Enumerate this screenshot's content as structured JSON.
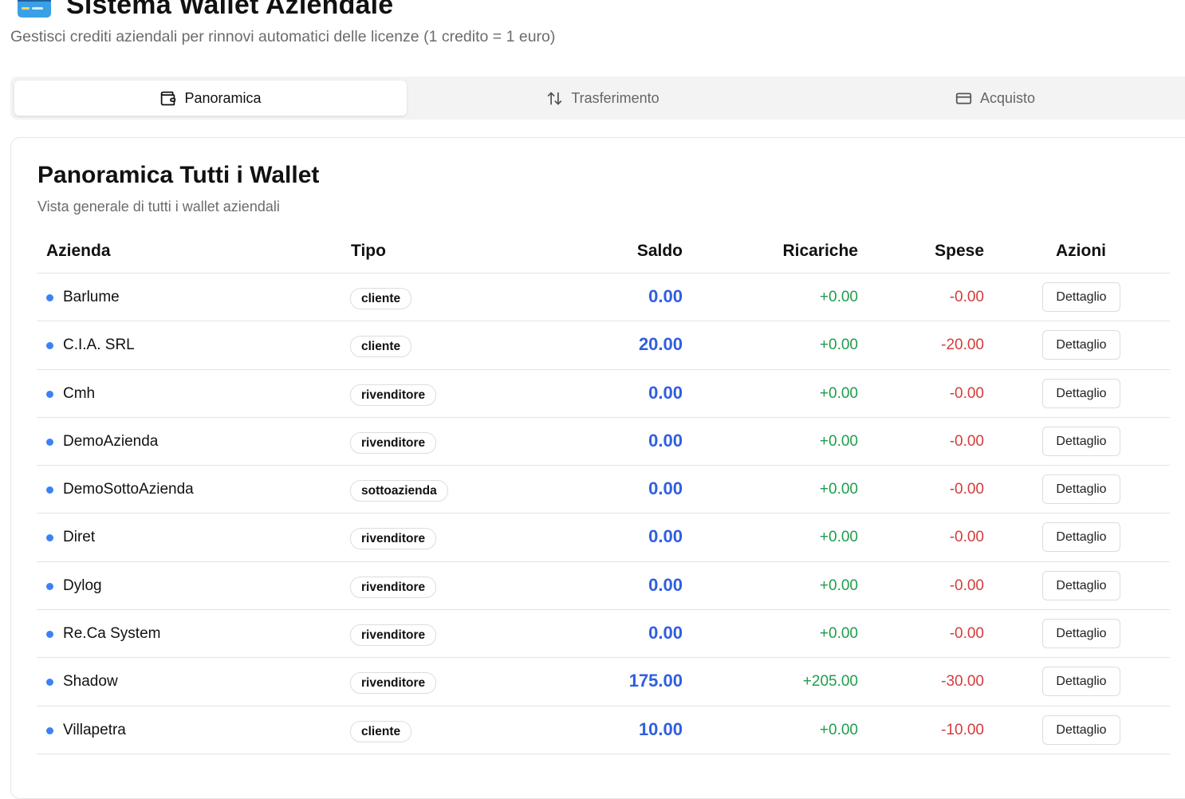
{
  "header": {
    "title": "Sistema Wallet Aziendale",
    "subtitle": "Gestisci crediti aziendali per rinnovi automatici delle licenze (1 credito = 1 euro)"
  },
  "tabs": [
    {
      "label": "Panoramica",
      "icon": "wallet-icon",
      "active": true
    },
    {
      "label": "Trasferimento",
      "icon": "arrows-up-down-icon",
      "active": false
    },
    {
      "label": "Acquisto",
      "icon": "credit-card-icon",
      "active": false
    }
  ],
  "panel": {
    "title": "Panoramica Tutti i Wallet",
    "description": "Vista generale di tutti i wallet aziendali"
  },
  "table": {
    "headers": {
      "azienda": "Azienda",
      "tipo": "Tipo",
      "saldo": "Saldo",
      "ricariche": "Ricariche",
      "spese": "Spese",
      "azioni": "Azioni"
    },
    "rows": [
      {
        "azienda": "Barlume",
        "tipo": "cliente",
        "saldo": "0.00",
        "ricariche": "+0.00",
        "spese": "-0.00",
        "azione": "Dettaglio"
      },
      {
        "azienda": "C.I.A. SRL",
        "tipo": "cliente",
        "saldo": "20.00",
        "ricariche": "+0.00",
        "spese": "-20.00",
        "azione": "Dettaglio"
      },
      {
        "azienda": "Cmh",
        "tipo": "rivenditore",
        "saldo": "0.00",
        "ricariche": "+0.00",
        "spese": "-0.00",
        "azione": "Dettaglio"
      },
      {
        "azienda": "DemoAzienda",
        "tipo": "rivenditore",
        "saldo": "0.00",
        "ricariche": "+0.00",
        "spese": "-0.00",
        "azione": "Dettaglio"
      },
      {
        "azienda": "DemoSottoAzienda",
        "tipo": "sottoazienda",
        "saldo": "0.00",
        "ricariche": "+0.00",
        "spese": "-0.00",
        "azione": "Dettaglio"
      },
      {
        "azienda": "Diret",
        "tipo": "rivenditore",
        "saldo": "0.00",
        "ricariche": "+0.00",
        "spese": "-0.00",
        "azione": "Dettaglio"
      },
      {
        "azienda": "Dylog",
        "tipo": "rivenditore",
        "saldo": "0.00",
        "ricariche": "+0.00",
        "spese": "-0.00",
        "azione": "Dettaglio"
      },
      {
        "azienda": "Re.Ca System",
        "tipo": "rivenditore",
        "saldo": "0.00",
        "ricariche": "+0.00",
        "spese": "-0.00",
        "azione": "Dettaglio"
      },
      {
        "azienda": "Shadow",
        "tipo": "rivenditore",
        "saldo": "175.00",
        "ricariche": "+205.00",
        "spese": "-30.00",
        "azione": "Dettaglio"
      },
      {
        "azienda": "Villapetra",
        "tipo": "cliente",
        "saldo": "10.00",
        "ricariche": "+0.00",
        "spese": "-10.00",
        "azione": "Dettaglio"
      }
    ]
  },
  "colors": {
    "saldo": "#2f5fe0",
    "ricariche": "#1f9d4c",
    "spese": "#d63b3b",
    "dot": "#3b82f6"
  }
}
